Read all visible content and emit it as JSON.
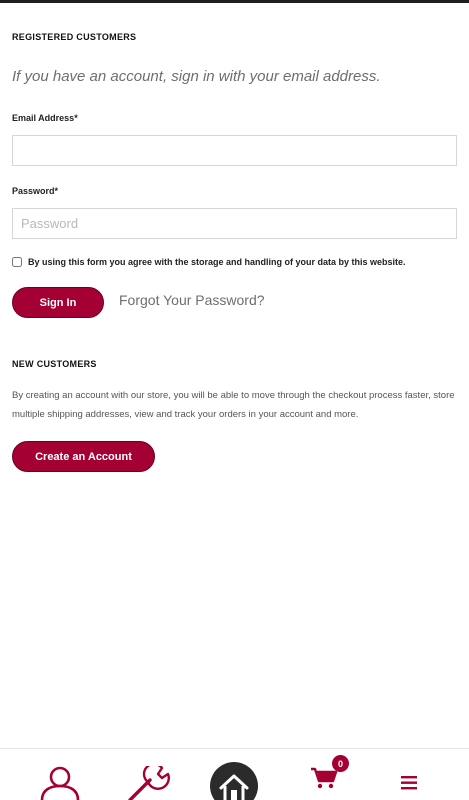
{
  "registered": {
    "title": "REGISTERED CUSTOMERS",
    "intro": "If you have an account, sign in with your email address.",
    "email_label": "Email Address",
    "email_value": "",
    "password_label": "Password",
    "password_placeholder": "Password",
    "consent_text": "By using this form you agree with the storage and handling of your data by this website.",
    "signin_label": "Sign In",
    "forgot_label": "Forgot Your Password?"
  },
  "new_customers": {
    "title": "NEW CUSTOMERS",
    "description": "By creating an account with our store, you will be able to move through the checkout process faster, store multiple shipping addresses, view and track your orders in your account and more.",
    "create_label": "Create an Account"
  },
  "bottom_nav": {
    "items": [
      {
        "icon": "user-icon"
      },
      {
        "icon": "wrench-icon"
      },
      {
        "icon": "home-icon"
      },
      {
        "icon": "cart-icon",
        "badge": "0"
      },
      {
        "icon": "menu-icon"
      }
    ]
  },
  "colors": {
    "accent": "#a50034",
    "text_muted": "#6e6e6e"
  }
}
